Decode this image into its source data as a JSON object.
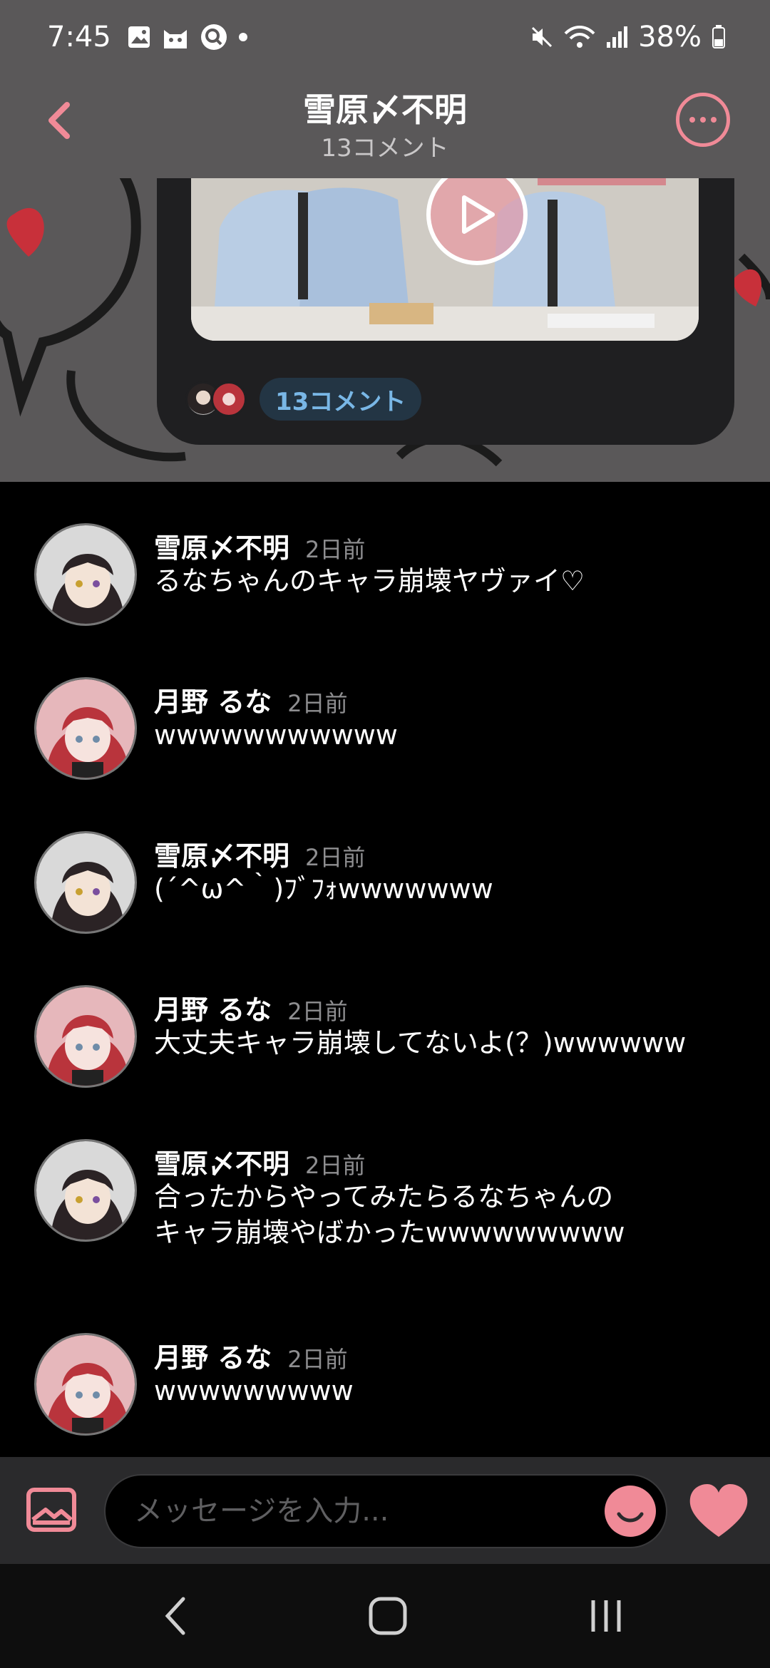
{
  "status_bar": {
    "time": "7:45",
    "battery": "38%",
    "left_icons": [
      "gallery-icon",
      "cat-icon",
      "search-app-icon",
      "dot-icon"
    ],
    "right_icons": [
      "mute-icon",
      "wifi-icon",
      "signal-icon",
      "battery-icon"
    ]
  },
  "header": {
    "title": "雪原〆不明",
    "subtitle": "13コメント"
  },
  "post": {
    "comment_chip": "13コメント"
  },
  "comments": [
    {
      "name": "雪原〆不明",
      "ago": "2日前",
      "text": "るなちゃんのキャラ崩壊ヤヴァイ♡",
      "avatar": "dark"
    },
    {
      "name": "月野 るな",
      "ago": "2日前",
      "text": "wwwwwwwwwww",
      "avatar": "red"
    },
    {
      "name": "雪原〆不明",
      "ago": "2日前",
      "text": "(´^ω^｀)ﾌﾞﾌｫwwwwwww",
      "avatar": "dark"
    },
    {
      "name": "月野 るな",
      "ago": "2日前",
      "text": "大丈夫キャラ崩壊してないよ(？)wwwwww",
      "avatar": "red"
    },
    {
      "name": "雪原〆不明",
      "ago": "2日前",
      "text": "合ったからやってみたらるなちゃんの\nキャラ崩壊やばかったwwwwwwwww",
      "avatar": "dark"
    },
    {
      "name": "月野 るな",
      "ago": "2日前",
      "text": "wwwwwwwww",
      "avatar": "red"
    }
  ],
  "input": {
    "placeholder": "メッセージを入力..."
  },
  "colors": {
    "accent": "#f08a97",
    "chip_bg": "#233544",
    "chip_text": "#79b7e6",
    "background": "#000000"
  }
}
